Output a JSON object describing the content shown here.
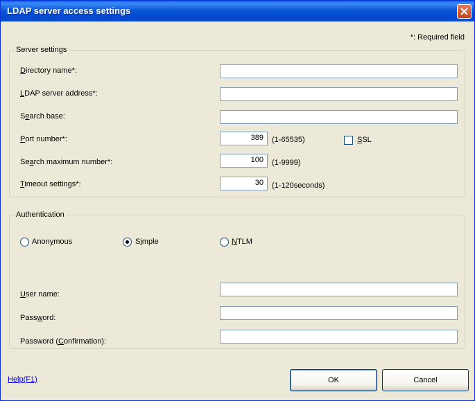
{
  "window": {
    "title": "LDAP server access settings"
  },
  "required_note": "*: Required field",
  "server_settings": {
    "legend": "Server settings",
    "directory_name": {
      "label_pre": "",
      "label_u": "D",
      "label_post": "irectory name*:",
      "value": ""
    },
    "ldap_server_address": {
      "label_pre": "",
      "label_u": "L",
      "label_post": "DAP server address*:",
      "value": ""
    },
    "search_base": {
      "label_pre": "S",
      "label_u": "e",
      "label_post": "arch base:",
      "value": ""
    },
    "port_number": {
      "label_pre": "",
      "label_u": "P",
      "label_post": "ort number*:",
      "value": "389",
      "range": "(1-65535)"
    },
    "ssl": {
      "label_pre": "",
      "label_u": "S",
      "label_post": "SL",
      "checked": false
    },
    "search_max": {
      "label_pre": "Se",
      "label_u": "a",
      "label_post": "rch maximum number*:",
      "value": "100",
      "range": "(1-9999)"
    },
    "timeout": {
      "label_pre": "",
      "label_u": "T",
      "label_post": "imeout settings*:",
      "value": "30",
      "range": "(1-120seconds)"
    }
  },
  "authentication": {
    "legend": "Authentication",
    "options": {
      "anonymous": {
        "label_pre": "Anon",
        "label_u": "y",
        "label_post": "mous",
        "selected": false
      },
      "simple": {
        "label_pre": "S",
        "label_u": "i",
        "label_post": "mple",
        "selected": true
      },
      "ntlm": {
        "label_pre": "",
        "label_u": "N",
        "label_post": "TLM",
        "selected": false
      }
    },
    "user_name": {
      "label_pre": "",
      "label_u": "U",
      "label_post": "ser name:",
      "value": ""
    },
    "password": {
      "label_pre": "Pass",
      "label_u": "w",
      "label_post": "ord:",
      "value": ""
    },
    "password_confirm": {
      "label_pre": "Password (",
      "label_u": "C",
      "label_post": "onfirmation):",
      "value": ""
    }
  },
  "footer": {
    "help_label": "Help(F1)",
    "ok_label": "OK",
    "cancel_label": "Cancel"
  },
  "colors": {
    "titlebar": "#0449d0",
    "dialog_bg": "#ece9d8",
    "link": "#0000ee",
    "close": "#c64019"
  }
}
